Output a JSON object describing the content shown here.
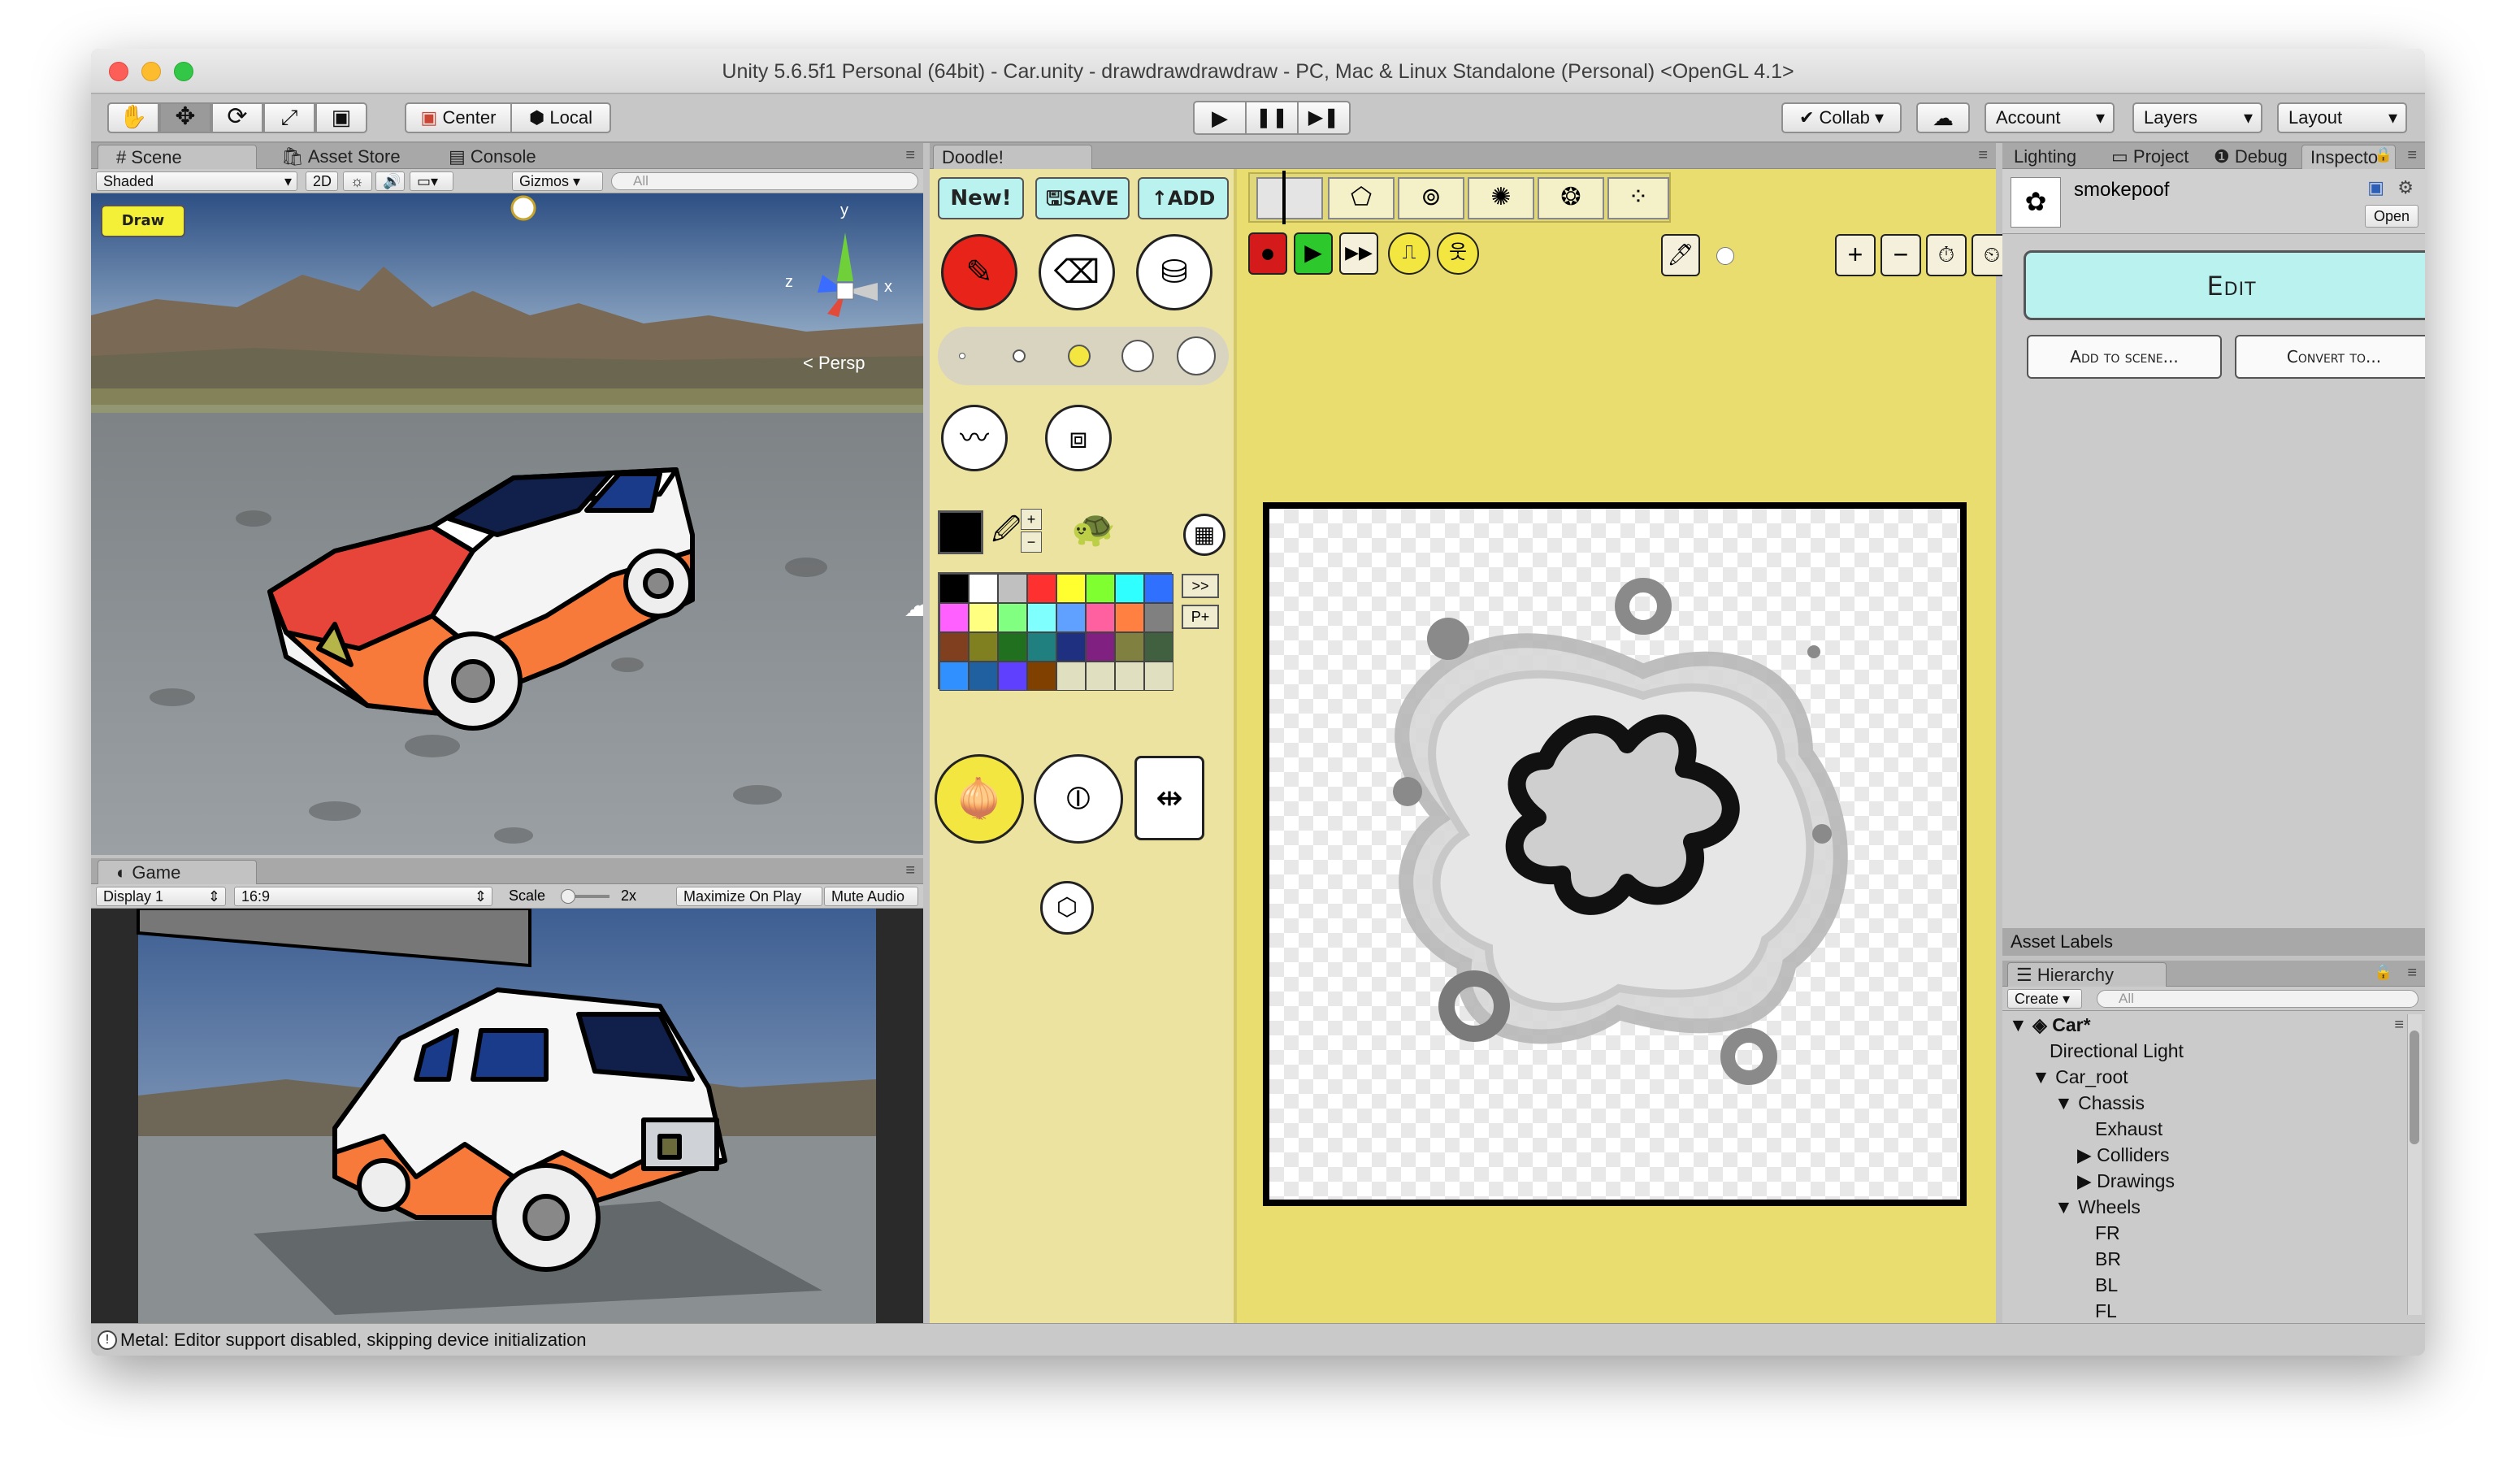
{
  "window": {
    "title": "Unity 5.6.5f1 Personal (64bit) - Car.unity - drawdrawdrawdraw - PC, Mac & Linux Standalone (Personal) <OpenGL 4.1>"
  },
  "toolbar": {
    "pivot_label": "Center",
    "space_label": "Local",
    "collab_label": "Collab",
    "account_label": "Account",
    "layers_label": "Layers",
    "layout_label": "Layout"
  },
  "scene": {
    "tabs": [
      "Scene",
      "Asset Store",
      "Console"
    ],
    "shading": "Shaded",
    "mode_2d": "2D",
    "gizmos": "Gizmos",
    "search_placeholder": "All",
    "draw_button": "Draw",
    "persp_label": "< Persp",
    "axis_labels": {
      "y": "y",
      "z": "z",
      "x": "x"
    }
  },
  "game": {
    "tab": "Game",
    "display": "Display 1",
    "aspect": "16:9",
    "scale_label": "Scale",
    "scale_value": "2x",
    "maximize": "Maximize On Play",
    "mute": "Mute Audio"
  },
  "doodle": {
    "tab": "Doodle!",
    "new_label": "New!",
    "save_label": "SAVE",
    "add_label": "ADD",
    "add_arrow": "↑",
    "grid_next": ">>",
    "grid_plus": "P+",
    "palette": [
      "#000000",
      "#ffffff",
      "#c0c0c0",
      "#ff3030",
      "#ffff30",
      "#80ff30",
      "#30ffff",
      "#3070ff",
      "#ff60ff",
      "#ffff80",
      "#80ff80",
      "#80ffff",
      "#60a0ff",
      "#ff60a0",
      "#ff8040",
      "#808080",
      "#804020",
      "#808020",
      "#207020",
      "#208080",
      "#203080",
      "#802080",
      "#808040",
      "#406040",
      "#3090ff",
      "#2060a0",
      "#6040ff",
      "#804000",
      "#e0e0c0",
      "#e0e0c0",
      "#e0e0c0",
      "#e0e0c0"
    ],
    "current_color": "#000000",
    "accent_yellow": "#e4da70",
    "canvas_bg": "#e8dd6e"
  },
  "inspector": {
    "tabs": [
      "Lighting",
      "Project",
      "Debug",
      "Inspecto"
    ],
    "asset_name": "smokepoof",
    "open_label": "Open",
    "edit_label": "Edit",
    "add_to_scene_label": "Add to scene...",
    "convert_label": "Convert to...",
    "asset_labels": "Asset Labels"
  },
  "hierarchy": {
    "tab": "Hierarchy",
    "create_label": "Create",
    "search_placeholder": "All",
    "scene_name": "Car*",
    "items": [
      {
        "label": "Directional Light"
      },
      {
        "label": "Car_root"
      },
      {
        "label": "Chassis"
      },
      {
        "label": "Exhaust"
      },
      {
        "label": "Colliders"
      },
      {
        "label": "Drawings"
      },
      {
        "label": "Wheels"
      },
      {
        "label": "FR"
      },
      {
        "label": "BR"
      },
      {
        "label": "BL"
      },
      {
        "label": "FL"
      }
    ]
  },
  "status": {
    "message": "Metal: Editor support disabled, skipping device initialization"
  }
}
